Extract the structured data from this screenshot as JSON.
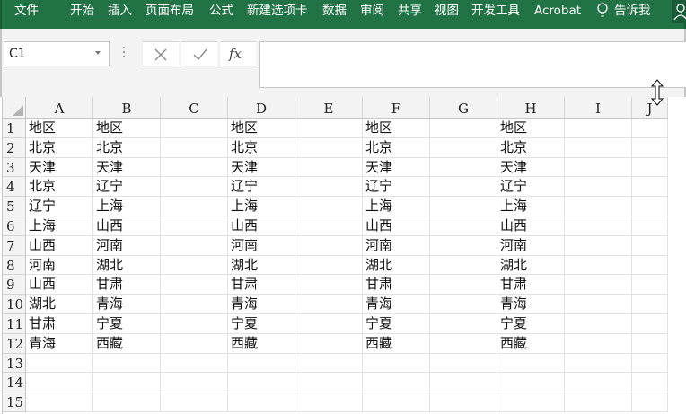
{
  "ribbon": {
    "tabs": [
      "文件",
      "开始",
      "插入",
      "页面布局",
      "公式",
      "新建选项卡",
      "数据",
      "审阅",
      "共享",
      "视图",
      "开发工具",
      "Acrobat"
    ],
    "tell_me": "告诉我",
    "background": "#217346"
  },
  "formula_bar": {
    "name_box": "C1",
    "cancel_icon": "cancel-x-icon",
    "enter_icon": "enter-check-icon",
    "function_label": "fx",
    "formula_value": ""
  },
  "sheet": {
    "columns": [
      "A",
      "B",
      "C",
      "D",
      "E",
      "F",
      "G",
      "H",
      "I",
      "J"
    ],
    "row_numbers": [
      "1",
      "2",
      "3",
      "4",
      "5",
      "6",
      "7",
      "8",
      "9",
      "10",
      "11",
      "12",
      "13",
      "14",
      "15"
    ],
    "cells": [
      [
        "地区",
        "地区",
        "",
        "地区",
        "",
        "地区",
        "",
        "地区",
        "",
        ""
      ],
      [
        "北京",
        "北京",
        "",
        "北京",
        "",
        "北京",
        "",
        "北京",
        "",
        ""
      ],
      [
        "天津",
        "天津",
        "",
        "天津",
        "",
        "天津",
        "",
        "天津",
        "",
        ""
      ],
      [
        "北京",
        "辽宁",
        "",
        "辽宁",
        "",
        "辽宁",
        "",
        "辽宁",
        "",
        ""
      ],
      [
        "辽宁",
        "上海",
        "",
        "上海",
        "",
        "上海",
        "",
        "上海",
        "",
        ""
      ],
      [
        "上海",
        "山西",
        "",
        "山西",
        "",
        "山西",
        "",
        "山西",
        "",
        ""
      ],
      [
        "山西",
        "河南",
        "",
        "河南",
        "",
        "河南",
        "",
        "河南",
        "",
        ""
      ],
      [
        "河南",
        "湖北",
        "",
        "湖北",
        "",
        "湖北",
        "",
        "湖北",
        "",
        ""
      ],
      [
        "山西",
        "甘肃",
        "",
        "甘肃",
        "",
        "甘肃",
        "",
        "甘肃",
        "",
        ""
      ],
      [
        "湖北",
        "青海",
        "",
        "青海",
        "",
        "青海",
        "",
        "青海",
        "",
        ""
      ],
      [
        "甘肃",
        "宁夏",
        "",
        "宁夏",
        "",
        "宁夏",
        "",
        "宁夏",
        "",
        ""
      ],
      [
        "青海",
        "西藏",
        "",
        "西藏",
        "",
        "西藏",
        "",
        "西藏",
        "",
        ""
      ],
      [
        "",
        "",
        "",
        "",
        "",
        "",
        "",
        "",
        "",
        ""
      ],
      [
        "",
        "",
        "",
        "",
        "",
        "",
        "",
        "",
        "",
        ""
      ],
      [
        "",
        "",
        "",
        "",
        "",
        "",
        "",
        "",
        "",
        ""
      ]
    ]
  }
}
